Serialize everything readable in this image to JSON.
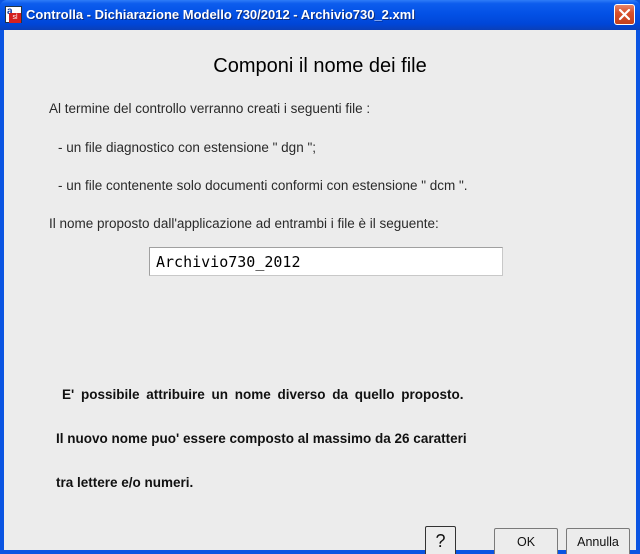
{
  "window": {
    "title": "Controlla - Dichiarazione Modello 730/2012 - Archivio730_2.xml",
    "icon": "app-icon"
  },
  "dialog": {
    "heading": "Componi il nome dei file",
    "intro": "Al termine del controllo verranno creati i seguenti file :",
    "item1": "- un file diagnostico con estensione \" dgn \";",
    "item2": "- un file contenente solo documenti conformi con estensione \" dcm \".",
    "proposal": "Il nome proposto dall'applicazione  ad  entrambi i file  è  il  seguente:",
    "filename_value": "Archivio730_2012",
    "note1": "E' possibile attribuire un nome diverso da quello proposto.",
    "note2": "Il nuovo nome puo' essere composto al massimo da 26 caratteri",
    "note3": "tra lettere  e/o  numeri."
  },
  "buttons": {
    "help": "?",
    "ok": "OK",
    "cancel": "Annulla"
  }
}
